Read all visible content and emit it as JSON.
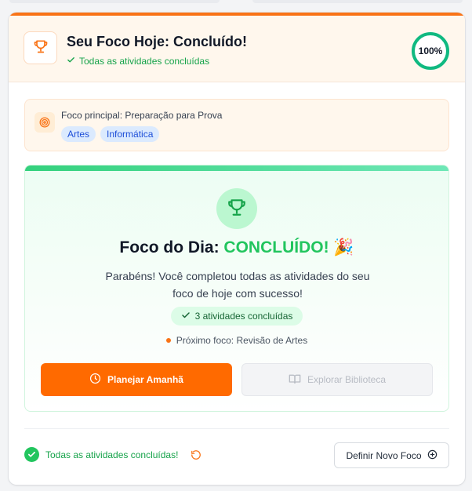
{
  "colors": {
    "accent": "#f97316",
    "success": "#22c55e",
    "tag_bg": "#dbeafe",
    "tag_text": "#1d4ed8"
  },
  "header": {
    "title": "Seu Foco Hoje: Concluído!",
    "subtitle": "Todas as atividades concluídas",
    "progress_label": "100%",
    "progress_fraction": 1.0,
    "icon": "trophy-icon"
  },
  "focus": {
    "label": "Foco principal: Preparação para Prova",
    "icon": "target-icon",
    "tags": [
      "Artes",
      "Informática"
    ]
  },
  "completion": {
    "icon": "trophy-icon",
    "title_prefix": "Foco do Dia: ",
    "title_highlight": "CONCLUÍDO!",
    "title_emoji": "🎉",
    "message": "Parabéns! Você completou todas as atividades do seu foco de hoje com sucesso!",
    "badge": "3 atividades concluídas",
    "next_focus": "Próximo foco: Revisão de Artes",
    "plan_button": "Planejar Amanhã",
    "explore_button": "Explorar Biblioteca"
  },
  "footer": {
    "status": "Todas as atividades concluídas!",
    "new_focus_button": "Definir Novo Foco"
  }
}
